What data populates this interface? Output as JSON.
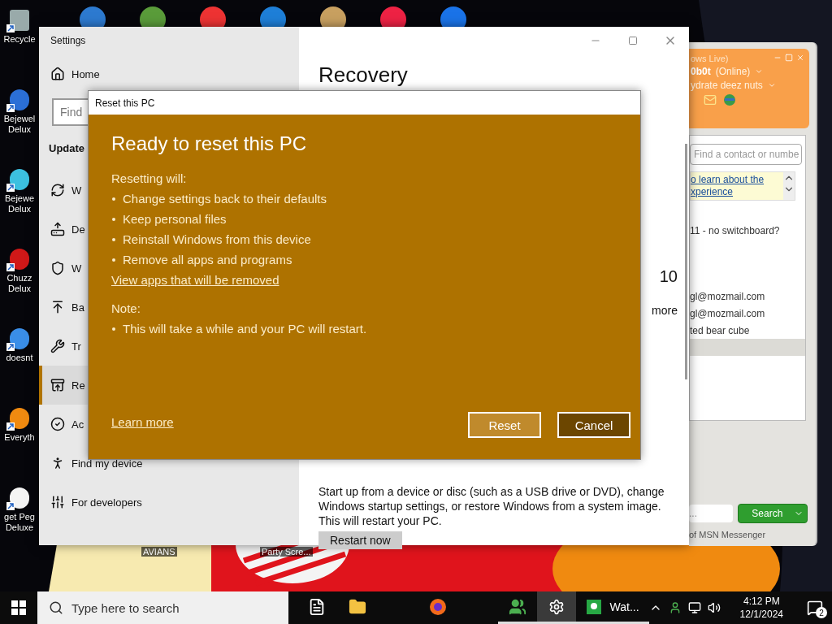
{
  "desktop": {
    "icons": [
      {
        "label": "Recycle"
      },
      {
        "label": "Bejewel Delux"
      },
      {
        "label": "Bejewe Delux"
      },
      {
        "label": "Chuzz Delux"
      },
      {
        "label": "doesnt"
      },
      {
        "label": "Everyth"
      },
      {
        "label": "get Peg Deluxe"
      }
    ],
    "bottom_icons": [
      {
        "label": "AVIANS"
      },
      {
        "label": "Party Scre..."
      }
    ]
  },
  "settings": {
    "title": "Settings",
    "home": "Home",
    "search": {
      "placeholder": "Find"
    },
    "section": "Update",
    "nav": [
      {
        "label": "W",
        "selected": false
      },
      {
        "label": "De",
        "selected": false
      },
      {
        "label": "W",
        "selected": false
      },
      {
        "label": "Ba",
        "selected": false
      },
      {
        "label": "Tr",
        "selected": false
      },
      {
        "label": "Re",
        "selected": true
      },
      {
        "label": "Ac",
        "selected": false
      },
      {
        "label": "Find my device",
        "selected": false
      },
      {
        "label": "For developers",
        "selected": false
      }
    ],
    "main": {
      "title": "Recovery",
      "fragments": [
        "10",
        "more"
      ],
      "description": "Start up from a device or disc (such as a USB drive or DVD), change Windows startup settings, or restore Windows from a system image. This will restart your PC.",
      "button": "Restart now"
    }
  },
  "dialog": {
    "title": "Reset this PC",
    "heading": "Ready to reset this PC",
    "intro": "Resetting will:",
    "bullets": [
      "Change settings back to their defaults",
      "Keep personal files",
      "Reinstall Windows from this device",
      "Remove all apps and programs"
    ],
    "link": "View apps that will be removed",
    "note_label": "Note:",
    "note_bullets": [
      "This will take a while and your PC will restart."
    ],
    "footer_link": "Learn more",
    "buttons": [
      {
        "label": "Reset",
        "hovered": true
      },
      {
        "label": "Cancel",
        "hovered": false
      }
    ]
  },
  "messenger": {
    "title": "ows Live)",
    "user": "0b0t",
    "status": "(Online)",
    "message": "ydrate deez nuts",
    "search": {
      "placeholder": "Find a contact or numbe"
    },
    "banner": [
      "o learn about the",
      "xperience"
    ],
    "contacts": [
      {
        "label": "11 - no switchboard?",
        "selected": false
      },
      {
        "label": "gl@mozmail.com",
        "selected": false
      },
      {
        "label": "gl@mozmail.com",
        "selected": false
      },
      {
        "label": "ted bear cube",
        "selected": false
      },
      {
        "selected": true
      }
    ],
    "bottom_search": {
      "placeholder": "..."
    },
    "search_button": "Search",
    "footer": "of MSN Messenger"
  },
  "taskbar": {
    "search": {
      "placeholder": "Type here to search"
    },
    "apps": [
      {
        "kind": "document",
        "open": false,
        "active": false
      },
      {
        "kind": "folder",
        "open": false,
        "active": false
      },
      {
        "kind": "browser",
        "open": false,
        "active": false
      },
      {
        "kind": "messenger",
        "open": true,
        "active": false
      },
      {
        "kind": "settings",
        "open": true,
        "active": true
      },
      {
        "kind": "window",
        "label": "Wat...",
        "open": true,
        "active": false
      }
    ],
    "clock": {
      "time": "4:12 PM",
      "date": "12/1/2024"
    },
    "notifications": "2"
  }
}
